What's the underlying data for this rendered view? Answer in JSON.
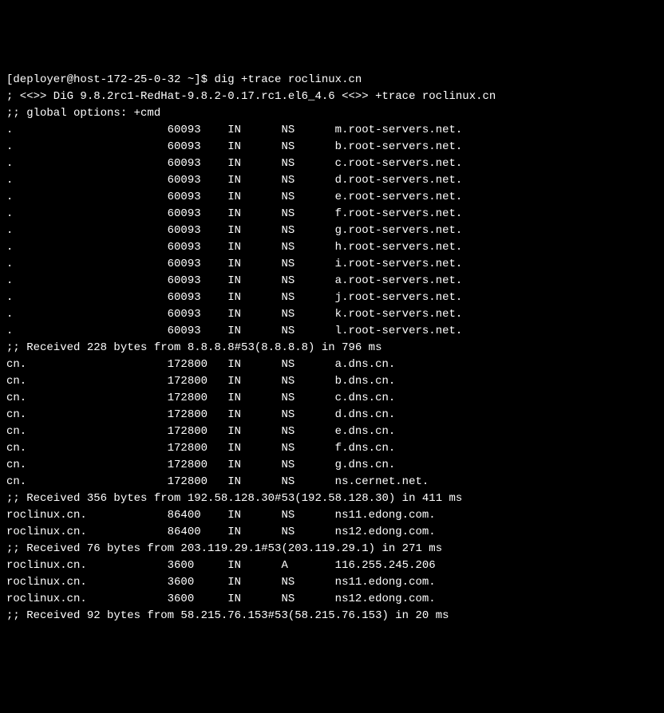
{
  "prompt": {
    "user": "deployer",
    "host": "host-172-25-0-32",
    "path": "~",
    "symbol": "$",
    "command": "dig +trace roclinux.cn"
  },
  "header": {
    "version_line": "; <<>> DiG 9.8.2rc1-RedHat-9.8.2-0.17.rc1.el6_4.6 <<>> +trace roclinux.cn",
    "options_line": ";; global options: +cmd"
  },
  "sections": [
    {
      "records": [
        {
          "name": ".",
          "ttl": "60093",
          "class": "IN",
          "type": "NS",
          "value": "m.root-servers.net."
        },
        {
          "name": ".",
          "ttl": "60093",
          "class": "IN",
          "type": "NS",
          "value": "b.root-servers.net."
        },
        {
          "name": ".",
          "ttl": "60093",
          "class": "IN",
          "type": "NS",
          "value": "c.root-servers.net."
        },
        {
          "name": ".",
          "ttl": "60093",
          "class": "IN",
          "type": "NS",
          "value": "d.root-servers.net."
        },
        {
          "name": ".",
          "ttl": "60093",
          "class": "IN",
          "type": "NS",
          "value": "e.root-servers.net."
        },
        {
          "name": ".",
          "ttl": "60093",
          "class": "IN",
          "type": "NS",
          "value": "f.root-servers.net."
        },
        {
          "name": ".",
          "ttl": "60093",
          "class": "IN",
          "type": "NS",
          "value": "g.root-servers.net."
        },
        {
          "name": ".",
          "ttl": "60093",
          "class": "IN",
          "type": "NS",
          "value": "h.root-servers.net."
        },
        {
          "name": ".",
          "ttl": "60093",
          "class": "IN",
          "type": "NS",
          "value": "i.root-servers.net."
        },
        {
          "name": ".",
          "ttl": "60093",
          "class": "IN",
          "type": "NS",
          "value": "a.root-servers.net."
        },
        {
          "name": ".",
          "ttl": "60093",
          "class": "IN",
          "type": "NS",
          "value": "j.root-servers.net."
        },
        {
          "name": ".",
          "ttl": "60093",
          "class": "IN",
          "type": "NS",
          "value": "k.root-servers.net."
        },
        {
          "name": ".",
          "ttl": "60093",
          "class": "IN",
          "type": "NS",
          "value": "l.root-servers.net."
        }
      ],
      "received": ";; Received 228 bytes from 8.8.8.8#53(8.8.8.8) in 796 ms"
    },
    {
      "records": [
        {
          "name": "cn.",
          "ttl": "172800",
          "class": "IN",
          "type": "NS",
          "value": "a.dns.cn."
        },
        {
          "name": "cn.",
          "ttl": "172800",
          "class": "IN",
          "type": "NS",
          "value": "b.dns.cn."
        },
        {
          "name": "cn.",
          "ttl": "172800",
          "class": "IN",
          "type": "NS",
          "value": "c.dns.cn."
        },
        {
          "name": "cn.",
          "ttl": "172800",
          "class": "IN",
          "type": "NS",
          "value": "d.dns.cn."
        },
        {
          "name": "cn.",
          "ttl": "172800",
          "class": "IN",
          "type": "NS",
          "value": "e.dns.cn."
        },
        {
          "name": "cn.",
          "ttl": "172800",
          "class": "IN",
          "type": "NS",
          "value": "f.dns.cn."
        },
        {
          "name": "cn.",
          "ttl": "172800",
          "class": "IN",
          "type": "NS",
          "value": "g.dns.cn."
        },
        {
          "name": "cn.",
          "ttl": "172800",
          "class": "IN",
          "type": "NS",
          "value": "ns.cernet.net."
        }
      ],
      "received": ";; Received 356 bytes from 192.58.128.30#53(192.58.128.30) in 411 ms"
    },
    {
      "records": [
        {
          "name": "roclinux.cn.",
          "ttl": "86400",
          "class": "IN",
          "type": "NS",
          "value": "ns11.edong.com."
        },
        {
          "name": "roclinux.cn.",
          "ttl": "86400",
          "class": "IN",
          "type": "NS",
          "value": "ns12.edong.com."
        }
      ],
      "received": ";; Received 76 bytes from 203.119.29.1#53(203.119.29.1) in 271 ms"
    },
    {
      "records": [
        {
          "name": "roclinux.cn.",
          "ttl": "3600",
          "class": "IN",
          "type": "A",
          "value": "116.255.245.206"
        },
        {
          "name": "roclinux.cn.",
          "ttl": "3600",
          "class": "IN",
          "type": "NS",
          "value": "ns11.edong.com."
        },
        {
          "name": "roclinux.cn.",
          "ttl": "3600",
          "class": "IN",
          "type": "NS",
          "value": "ns12.edong.com."
        }
      ],
      "received": ";; Received 92 bytes from 58.215.76.153#53(58.215.76.153) in 20 ms"
    }
  ],
  "columns": {
    "name_width": 24,
    "ttl_width": 9,
    "class_width": 8,
    "type_width": 8
  }
}
